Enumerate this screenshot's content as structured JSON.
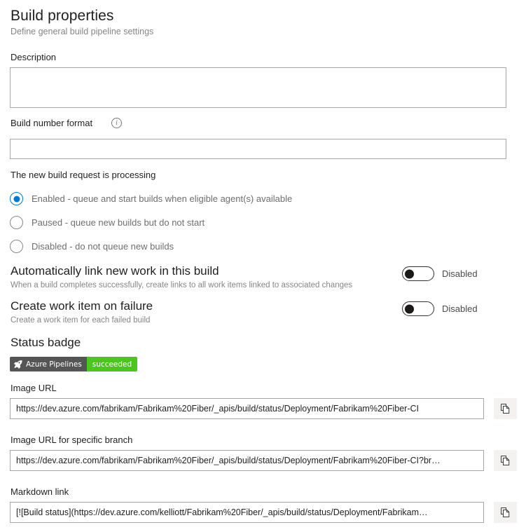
{
  "header": {
    "title": "Build properties",
    "subtitle": "Define general build pipeline settings"
  },
  "description": {
    "label": "Description",
    "value": "",
    "placeholder": ""
  },
  "build_number_format": {
    "label": "Build number format",
    "info_icon": "info-icon",
    "info_glyph": "i",
    "value": "",
    "placeholder": ""
  },
  "processing": {
    "label": "The new build request is processing",
    "options": [
      {
        "label": "Enabled - queue and start builds when eligible agent(s) available",
        "checked": true
      },
      {
        "label": "Paused - queue new builds but do not start",
        "checked": false
      },
      {
        "label": "Disabled - do not queue new builds",
        "checked": false
      }
    ]
  },
  "settings": [
    {
      "title": "Automatically link new work in this build",
      "description": "When a build completes successfully, create links to all work items linked to associated changes",
      "toggle_state": "Disabled"
    },
    {
      "title": "Create work item on failure",
      "description": "Create a work item for each failed build",
      "toggle_state": "Disabled"
    }
  ],
  "status_badge": {
    "heading": "Status badge",
    "left_label": "Azure Pipelines",
    "right_label": "succeeded",
    "left_color": "#555555",
    "right_color": "#4cc61e",
    "icon": "rocket-icon"
  },
  "urls": [
    {
      "label": "Image URL",
      "value": "https://dev.azure.com/fabrikam/Fabrikam%20Fiber/_apis/build/status/Deployment/Fabrikam%20Fiber-CI",
      "copy_icon": "copy-icon"
    },
    {
      "label": "Image URL for specific branch",
      "value": "https://dev.azure.com/fabrikam/Fabrikam%20Fiber/_apis/build/status/Deployment/Fabrikam%20Fiber-CI?br…",
      "copy_icon": "copy-icon"
    },
    {
      "label": "Markdown link",
      "value": "[![Build status](https://dev.azure.com/kelliott/Fabrikam%20Fiber/_apis/build/status/Deployment/Fabrikam…",
      "copy_icon": "copy-icon"
    }
  ],
  "colors": {
    "accent": "#0078d4",
    "text": "#1f1f1f",
    "muted": "#868686",
    "border": "#a6a6a6",
    "success": "#4cc61e"
  }
}
